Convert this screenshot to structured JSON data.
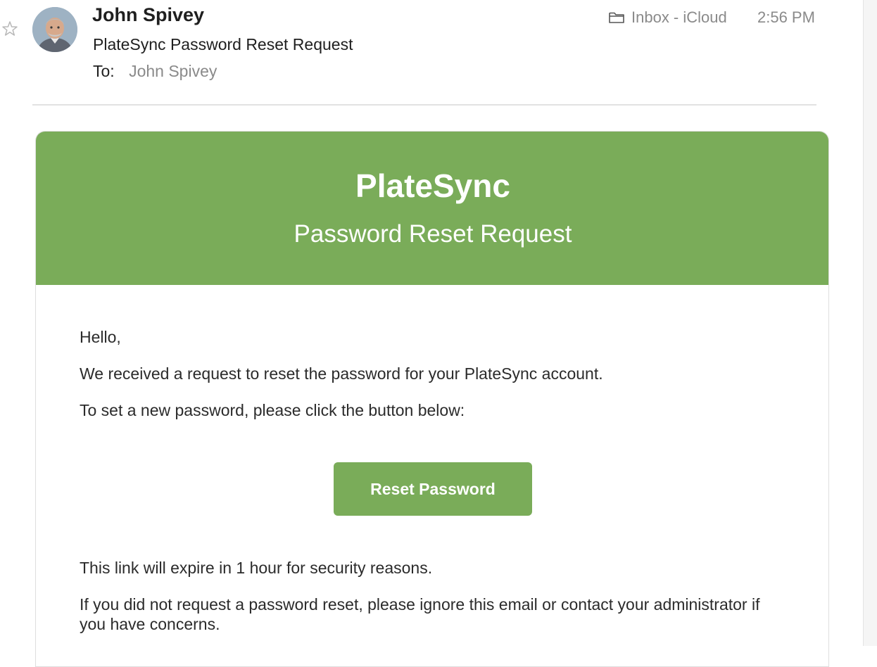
{
  "header": {
    "sender_name": "John Spivey",
    "subject": "PlateSync Password Reset Request",
    "to_label": "To:",
    "to_value": "John Spivey",
    "mailbox": "Inbox - iCloud",
    "time": "2:56 PM"
  },
  "icons": {
    "star": "star-icon",
    "folder": "folder-icon",
    "avatar": "avatar"
  },
  "email": {
    "brand": "PlateSync",
    "banner_subtitle": "Password Reset Request",
    "greeting": "Hello,",
    "line1": "We received a request to reset the password for your PlateSync account.",
    "line2": "To set a new password, please click the button below:",
    "button_label": "Reset Password",
    "line3": "This link will expire in 1 hour for security reasons.",
    "line4": "If you did not request a password reset, please ignore this email or contact your administrator if you have concerns."
  },
  "colors": {
    "brand_green": "#7aac59",
    "muted_text": "#8a8a8a",
    "body_text": "#2b2b2b"
  }
}
